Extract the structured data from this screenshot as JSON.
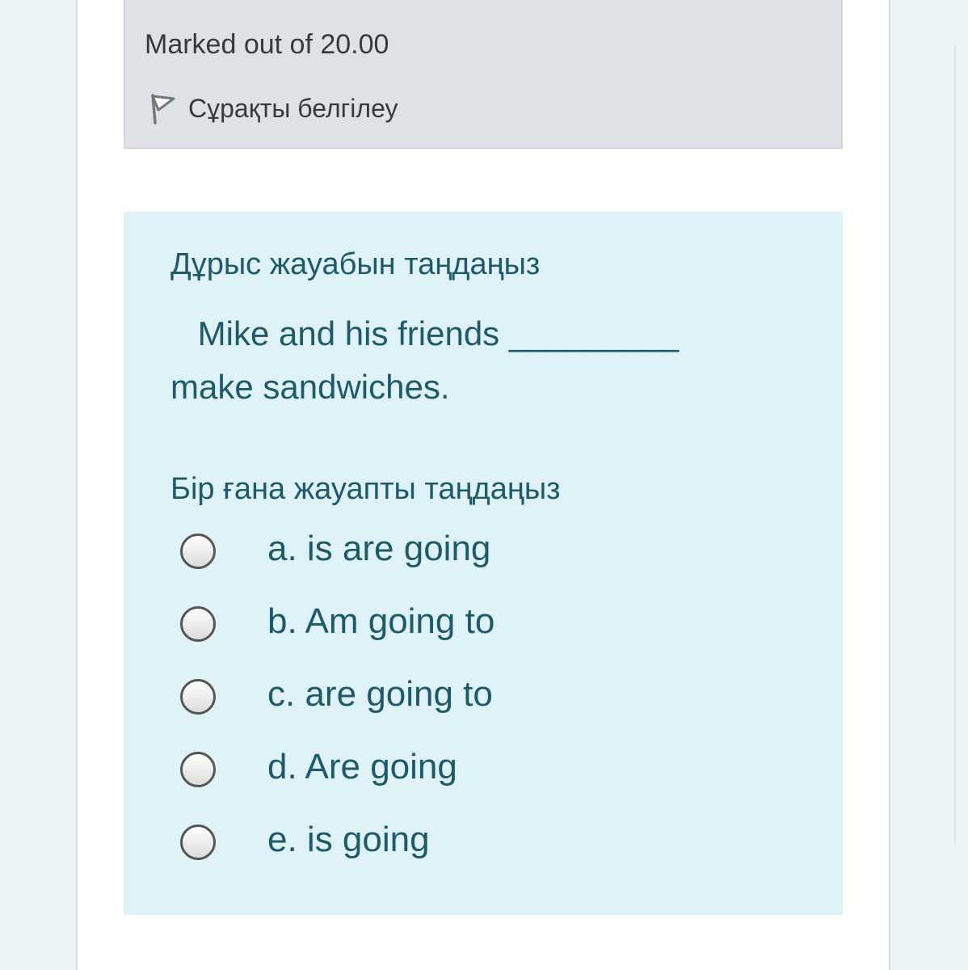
{
  "info": {
    "marked_text": "Marked out of 20.00",
    "flag_label": "Сұрақты белгілеу",
    "flag_icon": "flag-icon"
  },
  "question": {
    "instruction": "Дұрыс жауабын таңдаңыз",
    "text_line1": " Mike and his friends _________",
    "text_line2": "make sandwiches.",
    "prompt": "Бір ғана жауапты таңдаңыз",
    "answers": [
      {
        "label": "a. is are going",
        "selected": false
      },
      {
        "label": "b. Am going to",
        "selected": false
      },
      {
        "label": "c. are going to",
        "selected": false
      },
      {
        "label": "d. Are going",
        "selected": false
      },
      {
        "label": "e. is going",
        "selected": false
      }
    ]
  },
  "colors": {
    "page_background": "#edf4f8",
    "info_background": "#dee2e6",
    "question_background": "#def2f8",
    "question_text": "#1d5a6a"
  }
}
